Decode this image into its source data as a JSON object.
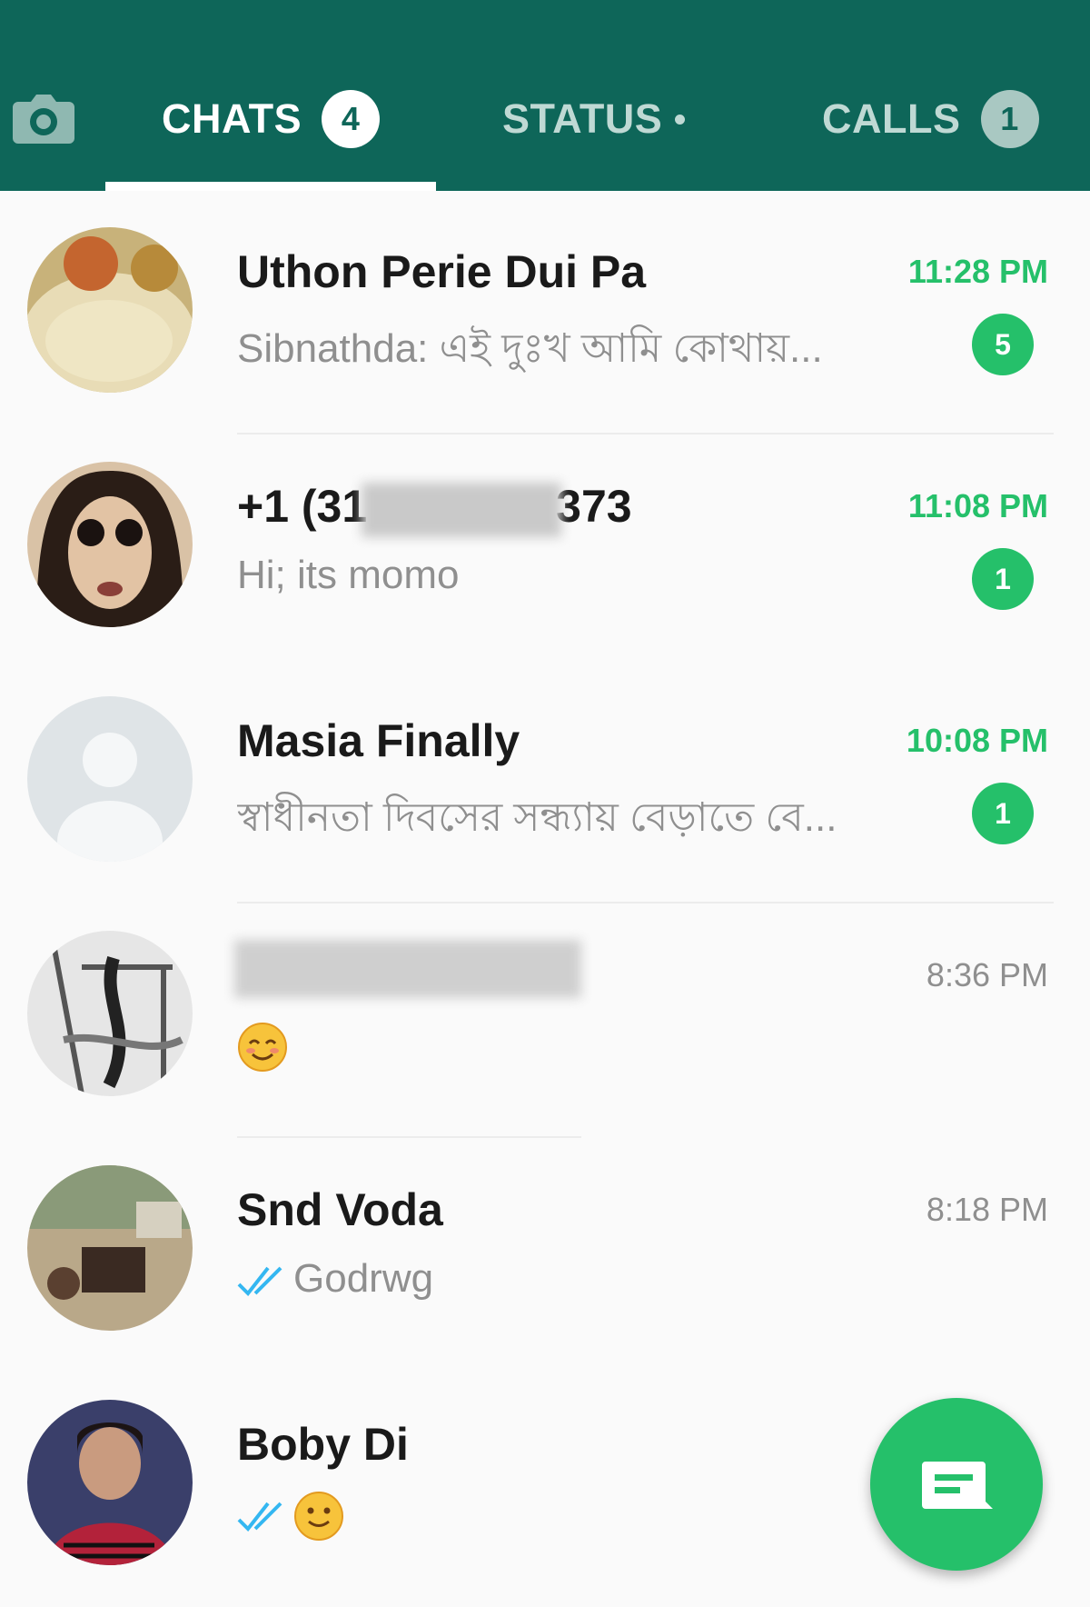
{
  "tabs": {
    "camera_icon": "camera-icon",
    "chats": {
      "label": "CHATS",
      "badge": "4"
    },
    "status": {
      "label": "STATUS"
    },
    "calls": {
      "label": "CALLS",
      "badge": "1"
    }
  },
  "colors": {
    "app_bar": "#0e6659",
    "accent_green": "#25c06a",
    "read_ticks": "#34b7f1"
  },
  "chats": [
    {
      "name": "Uthon Perie Dui Pa",
      "preview": "Sibnathda: এই দুঃখ আমি কোথায়...",
      "time": "11:28 PM",
      "unread": "5"
    },
    {
      "name": "+1 (31",
      "name_suffix": "373",
      "preview": "Hi; its momo",
      "time": "11:08 PM",
      "unread": "1"
    },
    {
      "name": "Masia Finally",
      "preview": "স্বাধীনতা দিবসের সন্ধ্যায় বেড়াতে বে...",
      "time": "10:08 PM",
      "unread": "1"
    },
    {
      "name": "",
      "preview_icon": "smiling-emoji",
      "time": "8:36 PM"
    },
    {
      "name": "Snd Voda",
      "preview_icon": "double-check-icon",
      "preview": "Godrwg",
      "time": "8:18 PM"
    },
    {
      "name": "Boby Di",
      "preview_icon": "double-check-icon"
    }
  ],
  "fab": {
    "icon": "new-chat-icon"
  }
}
